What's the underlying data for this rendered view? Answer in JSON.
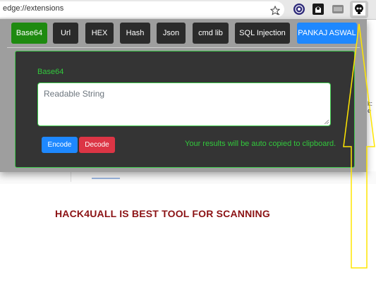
{
  "browser": {
    "url": "edge://extensions",
    "favorite_icon": "star-icon",
    "extension_icons": [
      "tor-icon",
      "hacker-icon",
      "puzzle-icon",
      "skull-extension-icon"
    ]
  },
  "popup": {
    "tabs": [
      {
        "label": "Base64",
        "state": "active"
      },
      {
        "label": "Url"
      },
      {
        "label": "HEX"
      },
      {
        "label": "Hash"
      },
      {
        "label": "Json"
      },
      {
        "label": "cmd lib"
      },
      {
        "label": "SQL Injection"
      },
      {
        "label": "PANKAJ ASWAL"
      }
    ],
    "panel": {
      "title": "Base64",
      "input_placeholder": "Readable String",
      "encode_label": "Encode",
      "decode_label": "Decode",
      "status_text": "Your results will be auto copied to clipboard."
    }
  },
  "banner_text": "HACK4UALL IS BEST TOOL FOR SCANNING",
  "colors": {
    "active_tab": "#1e8a10",
    "author_tab": "#1e88ff",
    "accent_green": "#32c83c",
    "encode": "#1e88ff",
    "decode": "#dc3545",
    "banner": "#8b1214",
    "arrow": "#ffe600"
  }
}
